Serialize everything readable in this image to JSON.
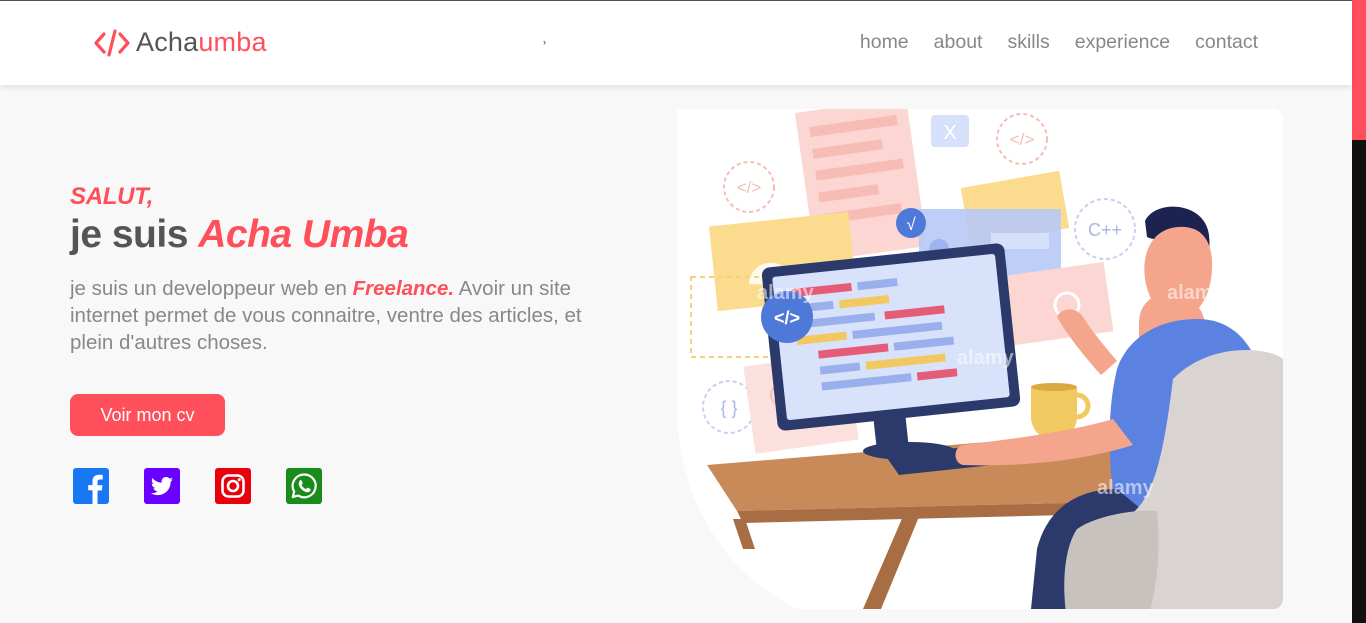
{
  "nav": {
    "logo_prefix": "Acha",
    "logo_accent": "umba",
    "logo_icon": "code-brackets-icon",
    "toggle_glyph": "›",
    "links": [
      "home",
      "about",
      "skills",
      "experience",
      "contact"
    ]
  },
  "hero": {
    "greeting": "SALUT,",
    "title_prefix": "je suis ",
    "title_name": "Acha Umba",
    "intro_before": "je suis un developpeur web en ",
    "intro_highlight": "Freelance.",
    "intro_after": " Avoir un site internet permet de vous connaitre, ventre des articles, et plein d'autres choses.",
    "cv_button": "Voir mon cv"
  },
  "socials": [
    {
      "name": "facebook-icon",
      "color": "#1877f2"
    },
    {
      "name": "twitter-icon",
      "color": "#6a00ff"
    },
    {
      "name": "instagram-icon",
      "color": "#e8000b"
    },
    {
      "name": "whatsapp-icon",
      "color": "#1a8c1a"
    }
  ],
  "illustration": {
    "watermark": "alamy",
    "badges": [
      "</>",
      "C++",
      "{ }",
      "X",
      "√"
    ]
  },
  "colors": {
    "accent": "#ff4f5a",
    "text": "#555555",
    "muted": "#888888",
    "background": "#f8f8f8"
  }
}
